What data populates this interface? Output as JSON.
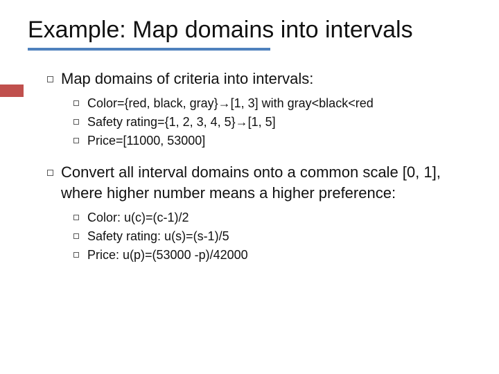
{
  "title": "Example: Map domains into intervals",
  "sections": [
    {
      "heading": "Map domains of criteria into intervals:",
      "items": [
        "Color={red, black, gray}→[1, 3] with gray<black<red",
        "Safety rating={1, 2, 3, 4, 5}→[1, 5]",
        "Price=[11000, 53000]"
      ]
    },
    {
      "heading": "Convert all interval domains onto a common scale [0, 1], where higher number means a higher preference:",
      "items": [
        "Color: u(c)=(c-1)/2",
        "Safety rating: u(s)=(s-1)/5",
        "Price: u(p)=(53000 -p)/42000"
      ]
    }
  ]
}
